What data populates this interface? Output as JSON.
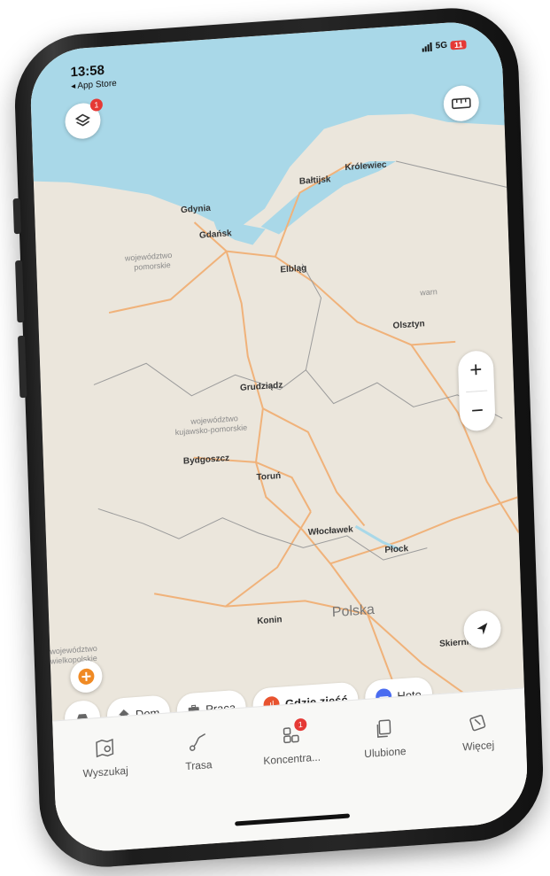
{
  "status_bar": {
    "time": "13:58",
    "back_label": "◂ App Store",
    "network": "5G",
    "battery": "11"
  },
  "top_buttons": {
    "layers_badge": "1"
  },
  "map": {
    "water_color": "#a9d8e8",
    "land_color": "#ebe6dc",
    "road_color": "#f0b27a",
    "labels": {
      "gdynia": "Gdynia",
      "gdansk": "Gdańsk",
      "baltijsk": "Bałtijsk",
      "krolewiec": "Królewiec",
      "region_pomorskie_1": "województwo",
      "region_pomorskie_2": "pomorskie",
      "elblag": "Elbląg",
      "olsztyn": "Olsztyn",
      "warm": "warn",
      "grudziadz": "Grudziądz",
      "region_kuj_1": "województwo",
      "region_kuj_2": "kujawsko-pomorskie",
      "bydgoszcz": "Bydgoszcz",
      "torun": "Toruń",
      "wloclawek": "Włocławek",
      "plock": "Płock",
      "polska": "Polska",
      "konin": "Konin",
      "region_wlkp_1": "województwo",
      "region_wlkp_2": "wielkopolskie",
      "skierniewice": "Skierniewi"
    }
  },
  "zoom": {
    "plus": "+",
    "minus": "−"
  },
  "chips": [
    {
      "label": "",
      "icon": "car-icon"
    },
    {
      "label": "Dom",
      "icon": "home-icon"
    },
    {
      "label": "Praca",
      "icon": "briefcase-icon"
    },
    {
      "label": "Gdzie zjeść",
      "icon": "restaurant-icon",
      "color": "#e8532f"
    },
    {
      "label": "Hote",
      "icon": "hotel-icon",
      "color": "#4a6cf0"
    }
  ],
  "tabs": [
    {
      "label": "Wyszukaj",
      "icon": "map-search-icon"
    },
    {
      "label": "Trasa",
      "icon": "route-icon"
    },
    {
      "label": "Koncentra...",
      "icon": "grid-icon",
      "badge": "1"
    },
    {
      "label": "Ulubione",
      "icon": "favorites-icon"
    },
    {
      "label": "Więcej",
      "icon": "more-icon"
    }
  ],
  "colors": {
    "accent_orange": "#f08a24",
    "badge_red": "#e53935"
  }
}
